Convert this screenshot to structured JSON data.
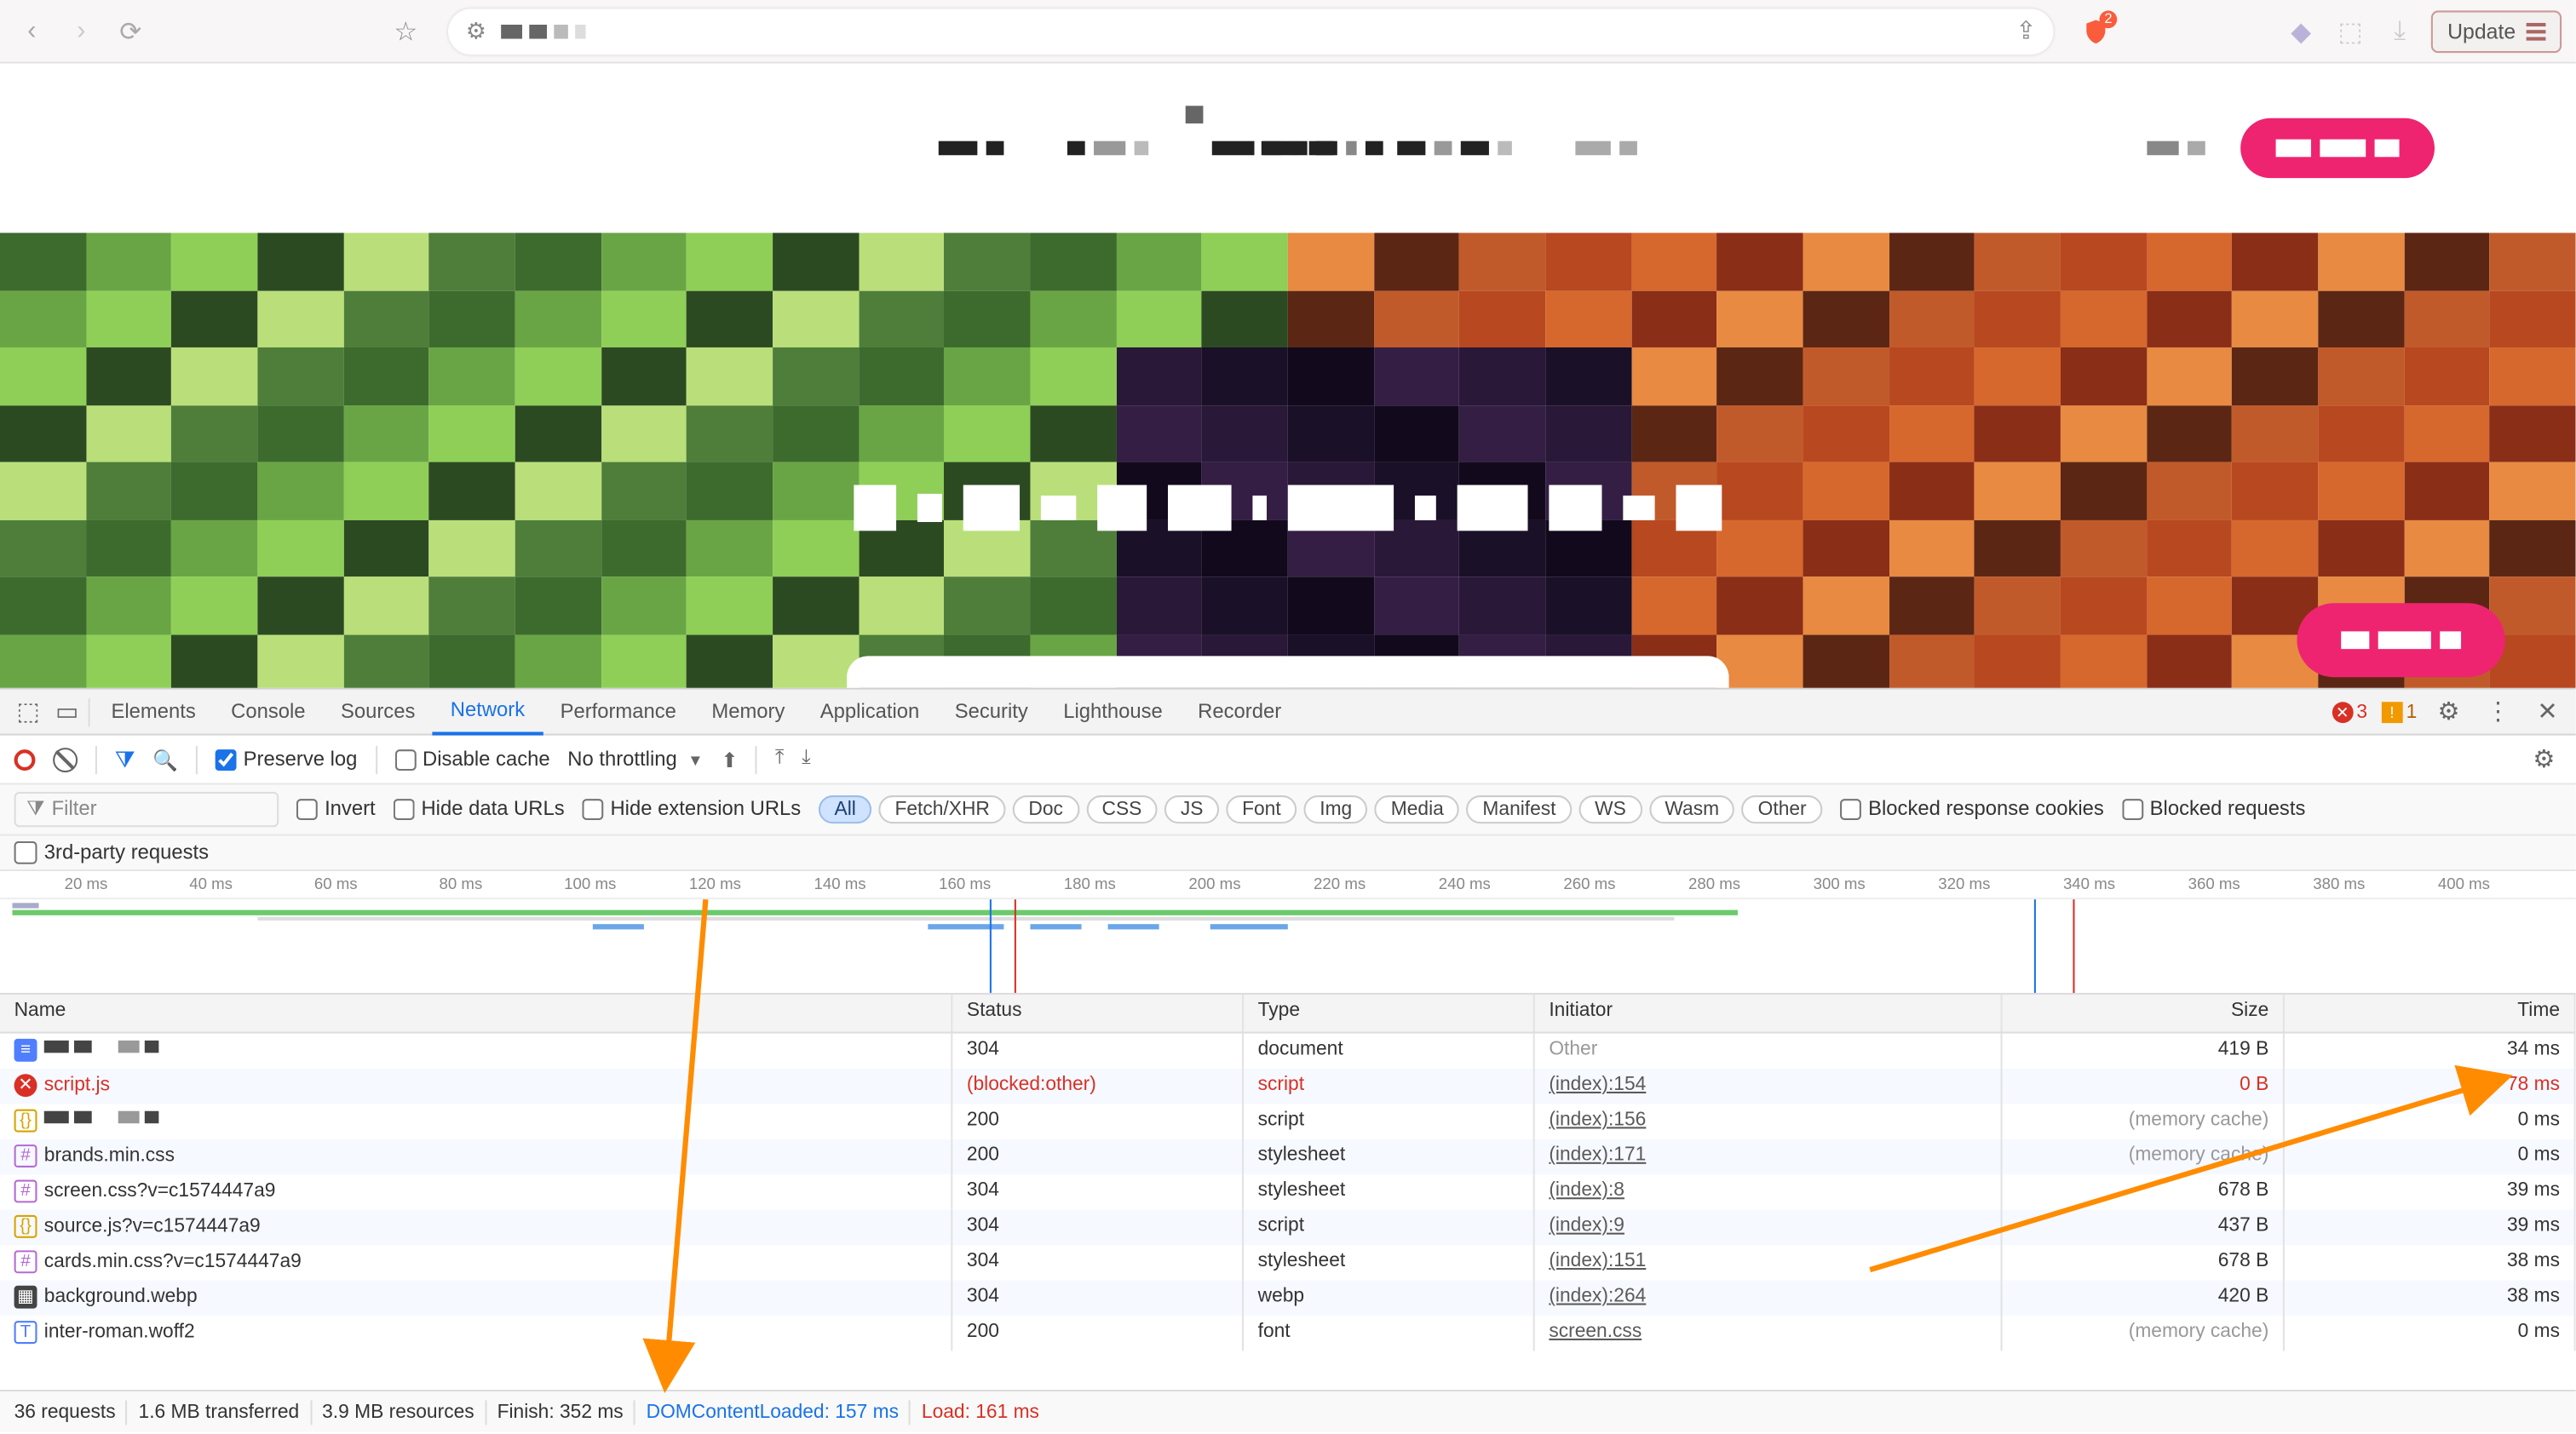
{
  "browser": {
    "update_label": "Update",
    "shield_badge": "2"
  },
  "devtools": {
    "tabs": [
      "Elements",
      "Console",
      "Sources",
      "Network",
      "Performance",
      "Memory",
      "Application",
      "Security",
      "Lighthouse",
      "Recorder"
    ],
    "active_tab": "Network",
    "errors": "3",
    "warnings": "1",
    "toolbar": {
      "preserve_log": "Preserve log",
      "disable_cache": "Disable cache",
      "throttling": "No throttling"
    },
    "filters": {
      "placeholder": "Filter",
      "invert": "Invert",
      "hide_data_urls": "Hide data URLs",
      "hide_ext_urls": "Hide extension URLs",
      "chips": [
        "All",
        "Fetch/XHR",
        "Doc",
        "CSS",
        "JS",
        "Font",
        "Img",
        "Media",
        "Manifest",
        "WS",
        "Wasm",
        "Other"
      ],
      "active_chip": "All",
      "blocked_cookies": "Blocked response cookies",
      "blocked_requests": "Blocked requests",
      "third_party": "3rd-party requests"
    },
    "timeline_ticks": [
      "20 ms",
      "40 ms",
      "60 ms",
      "80 ms",
      "100 ms",
      "120 ms",
      "140 ms",
      "160 ms",
      "180 ms",
      "200 ms",
      "220 ms",
      "240 ms",
      "260 ms",
      "280 ms",
      "300 ms",
      "320 ms",
      "340 ms",
      "360 ms",
      "380 ms",
      "400 ms"
    ],
    "table": {
      "headers": {
        "name": "Name",
        "status": "Status",
        "type": "Type",
        "initiator": "Initiator",
        "size": "Size",
        "time": "Time"
      },
      "rows": [
        {
          "icon": "doc",
          "name_px": true,
          "status": "304",
          "type": "document",
          "initiator": "Other",
          "init_link": false,
          "size": "419 B",
          "time": "34 ms",
          "err": false
        },
        {
          "icon": "err",
          "name": "script.js",
          "status": "(blocked:other)",
          "type": "script",
          "initiator": "(index):154",
          "init_link": true,
          "size": "0 B",
          "time": "78 ms",
          "err": true
        },
        {
          "icon": "js",
          "name_px": true,
          "status": "200",
          "type": "script",
          "initiator": "(index):156",
          "init_link": true,
          "size": "(memory cache)",
          "time": "0 ms",
          "err": false,
          "mem": true
        },
        {
          "icon": "css",
          "name": "brands.min.css",
          "status": "200",
          "type": "stylesheet",
          "initiator": "(index):171",
          "init_link": true,
          "size": "(memory cache)",
          "time": "0 ms",
          "err": false,
          "mem": true
        },
        {
          "icon": "css",
          "name": "screen.css?v=c1574447a9",
          "status": "304",
          "type": "stylesheet",
          "initiator": "(index):8",
          "init_link": true,
          "size": "678 B",
          "time": "39 ms",
          "err": false
        },
        {
          "icon": "js",
          "name": "source.js?v=c1574447a9",
          "status": "304",
          "type": "script",
          "initiator": "(index):9",
          "init_link": true,
          "size": "437 B",
          "time": "39 ms",
          "err": false
        },
        {
          "icon": "css",
          "name": "cards.min.css?v=c1574447a9",
          "status": "304",
          "type": "stylesheet",
          "initiator": "(index):151",
          "init_link": true,
          "size": "678 B",
          "time": "38 ms",
          "err": false
        },
        {
          "icon": "img",
          "name": "background.webp",
          "status": "304",
          "type": "webp",
          "initiator": "(index):264",
          "init_link": true,
          "size": "420 B",
          "time": "38 ms",
          "err": false
        },
        {
          "icon": "font",
          "name": "inter-roman.woff2",
          "status": "200",
          "type": "font",
          "initiator": "screen.css",
          "init_link": true,
          "size": "(memory cache)",
          "time": "0 ms",
          "err": false,
          "mem": true
        }
      ]
    },
    "status": {
      "requests": "36 requests",
      "transferred": "1.6 MB transferred",
      "resources": "3.9 MB resources",
      "finish": "Finish: 352 ms",
      "dcl": "DOMContentLoaded: 157 ms",
      "load": "Load: 161 ms"
    }
  }
}
